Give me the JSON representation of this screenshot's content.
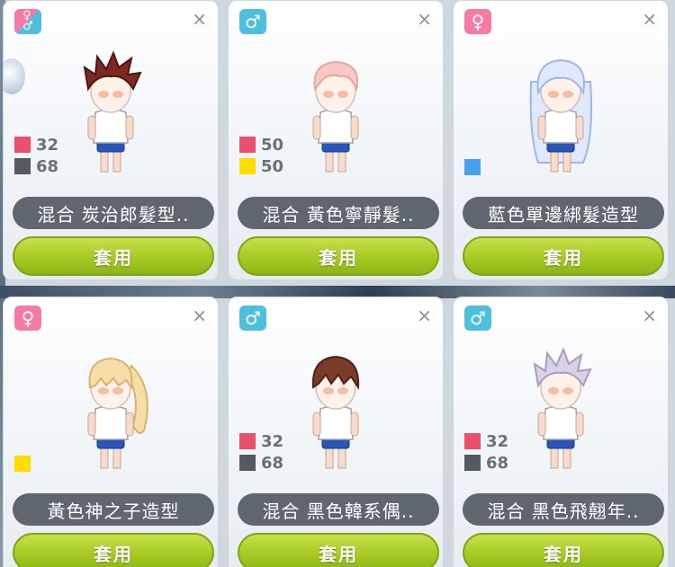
{
  "colors": {
    "red": "#e8506e",
    "gray": "#555a60",
    "yellow": "#ffdd00",
    "blue": "#4aa0ea",
    "male_badge": "#4ec0dc",
    "female_badge": "#f57aa6",
    "apply_green": "#a6ca23"
  },
  "icons": {
    "male": "♂",
    "female": "♀",
    "close": "×"
  },
  "cards": [
    {
      "gender": "both",
      "name": "混合 炭治郎髮型..",
      "mix": [
        {
          "color": "#e8506e",
          "percent": "32"
        },
        {
          "color": "#555a60",
          "percent": "68"
        }
      ],
      "hair": "dark-red-spiky",
      "apply_label": "套用"
    },
    {
      "gender": "male",
      "name": "混合 黃色寧靜髮..",
      "mix": [
        {
          "color": "#e8506e",
          "percent": "50"
        },
        {
          "color": "#ffdd00",
          "percent": "50"
        }
      ],
      "hair": "pink-soft",
      "apply_label": "套用"
    },
    {
      "gender": "female",
      "name": "藍色單邊綁髮造型",
      "swatch": "#4aa0ea",
      "hair": "white-blue-long",
      "apply_label": "套用"
    },
    {
      "gender": "female",
      "name": "黃色神之子造型",
      "swatch": "#ffdd00",
      "hair": "blonde-ponytail",
      "apply_label": "套用"
    },
    {
      "gender": "male",
      "name": "混合 黑色韓系偶..",
      "mix": [
        {
          "color": "#e8506e",
          "percent": "32"
        },
        {
          "color": "#555a60",
          "percent": "68"
        }
      ],
      "hair": "brown-fringe",
      "apply_label": "套用"
    },
    {
      "gender": "male",
      "name": "混合 黑色飛翹年..",
      "mix": [
        {
          "color": "#e8506e",
          "percent": "32"
        },
        {
          "color": "#555a60",
          "percent": "68"
        }
      ],
      "hair": "lavender-spiky",
      "apply_label": "套用"
    }
  ]
}
